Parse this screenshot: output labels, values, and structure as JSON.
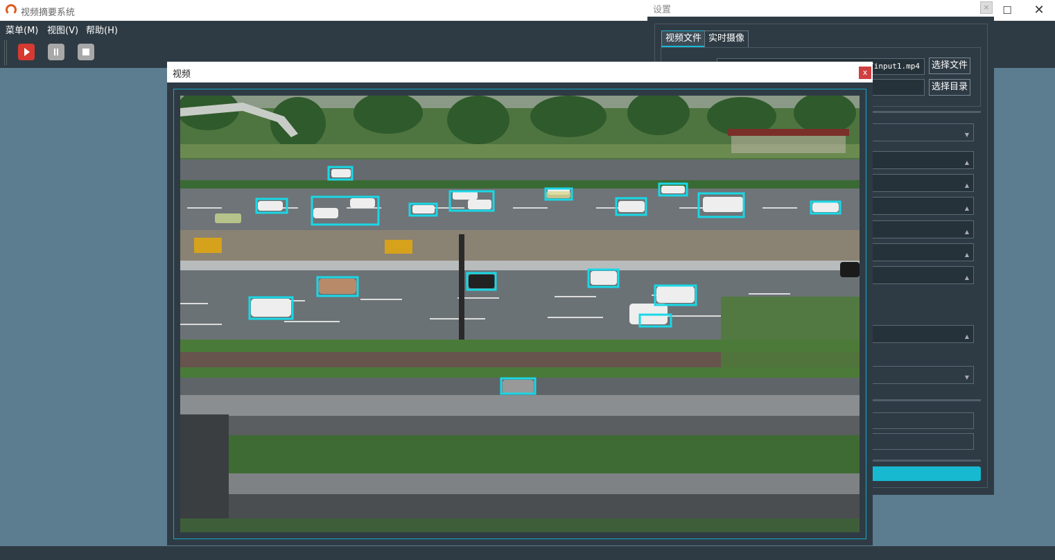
{
  "app": {
    "title": "视频摘要系统",
    "logo_icon": "app-logo-icon"
  },
  "window_controls": {
    "minimize": "—",
    "maximize": "☐",
    "close": "✕"
  },
  "menu": [
    {
      "label": "菜单(M)"
    },
    {
      "label": "视图(V)"
    },
    {
      "label": "帮助(H)"
    }
  ],
  "toolbar": {
    "play_icon": "play-icon",
    "pause_icon": "pause-icon",
    "stop_icon": "stop-icon"
  },
  "settings": {
    "title": "设置",
    "close_label": "×",
    "tabs": [
      {
        "label": "视频文件",
        "active": true
      },
      {
        "label": "实时摄像",
        "active": false
      }
    ],
    "file_path": "/input1.mp4",
    "select_file_label": "选择文件",
    "select_dir_label": "选择目录"
  },
  "video": {
    "title": "视频",
    "close_label": "x"
  },
  "colors": {
    "panel": "#2f3b44",
    "accent": "#17b9d1",
    "detection_box": "#19d8e6",
    "play_button": "#d63a30"
  }
}
